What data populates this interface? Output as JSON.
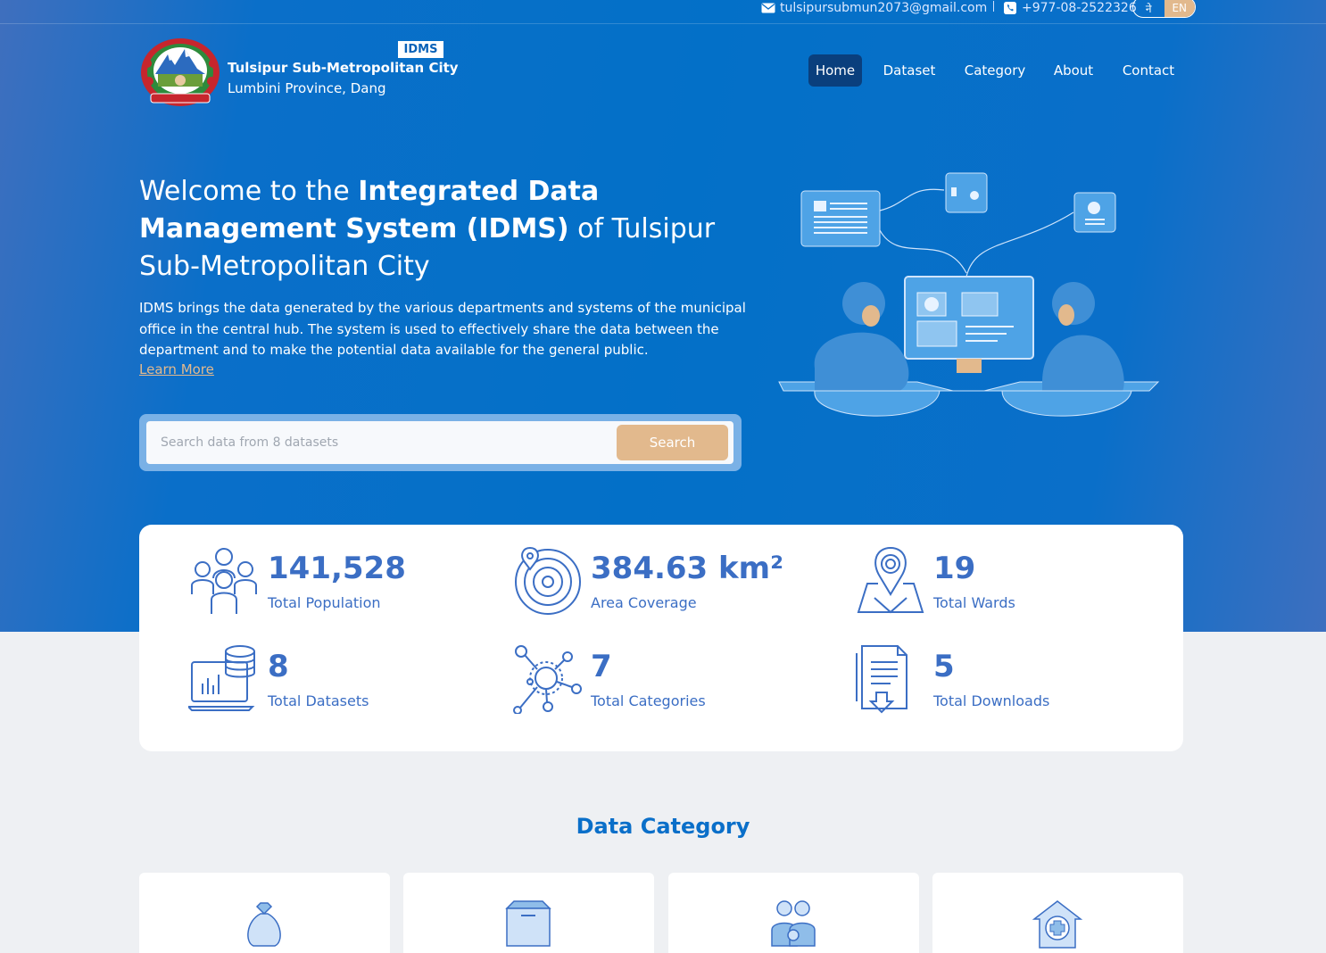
{
  "topbar": {
    "email": "tulsipursubmun2073@gmail.com",
    "phone": "+977-08-2522326",
    "lang_ne": "ने",
    "lang_en": "EN"
  },
  "brand": {
    "badge": "IDMS",
    "name": "Tulsipur Sub-Metropolitan City",
    "sub": "Lumbini Province, Dang"
  },
  "nav": [
    "Home",
    "Dataset",
    "Category",
    "About",
    "Contact"
  ],
  "hero": {
    "title_pre": "Welcome to the ",
    "title_bold": "Integrated Data Management System (IDMS)",
    "title_post": " of Tulsipur Sub-Metropolitan City",
    "description": "IDMS brings the data generated by the various departments and systems of the municipal office in the central hub. The system is used to effectively share the data between the department and to make the potential data available for the general public.",
    "learn_more": "Learn More"
  },
  "search": {
    "placeholder": "Search data from 8 datasets",
    "button": "Search"
  },
  "stats": [
    {
      "value": "141,528",
      "label": "Total Population",
      "icon": "population-icon"
    },
    {
      "value": "384.63 km²",
      "label": "Area Coverage",
      "icon": "radar-icon"
    },
    {
      "value": "19",
      "label": "Total Wards",
      "icon": "map-pin-icon"
    },
    {
      "value": "8",
      "label": "Total Datasets",
      "icon": "database-icon"
    },
    {
      "value": "7",
      "label": "Total Categories",
      "icon": "network-icon"
    },
    {
      "value": "5",
      "label": "Total Downloads",
      "icon": "document-download-icon"
    }
  ],
  "section": {
    "title": "Data Category"
  },
  "categories": [
    {
      "icon": "money-bag-icon"
    },
    {
      "icon": "box-icon"
    },
    {
      "icon": "family-icon"
    },
    {
      "icon": "health-house-icon"
    }
  ],
  "colors": {
    "primary": "#0370c8",
    "accent": "#e2b98d",
    "stat_text": "#3b6ec4",
    "nav_active": "#0a3f7d"
  }
}
